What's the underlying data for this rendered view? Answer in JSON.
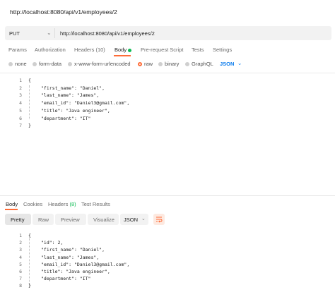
{
  "title": "http://localhost:8080/api/v1/employees/2",
  "request": {
    "method": "PUT",
    "url": "http://localhost:8080/api/v1/employees/2"
  },
  "tabs": {
    "params": "Params",
    "authorization": "Authorization",
    "headers": "Headers",
    "headers_count": "(10)",
    "body": "Body",
    "prerequest": "Pre-request Script",
    "tests": "Tests",
    "settings": "Settings"
  },
  "body_options": {
    "none": "none",
    "form_data": "form-data",
    "urlencoded": "x-www-form-urlencoded",
    "raw": "raw",
    "binary": "binary",
    "graphql": "GraphQL",
    "format": "JSON",
    "selected": "raw"
  },
  "request_body": {
    "lines": [
      {
        "num": "1",
        "text": "{"
      },
      {
        "num": "2",
        "text": "\"first_name\": \"Daniel\","
      },
      {
        "num": "3",
        "text": "\"last_name\": \"James\","
      },
      {
        "num": "4",
        "text": "\"email_id\": \"Daniel3@gmail.com\","
      },
      {
        "num": "5",
        "text": "\"title\": \"Java engineer\","
      },
      {
        "num": "6",
        "text": "\"department\": \"IT\""
      },
      {
        "num": "7",
        "text": "}"
      }
    ]
  },
  "response_tabs": {
    "body": "Body",
    "cookies": "Cookies",
    "headers": "Headers",
    "headers_count": "(8)",
    "test_results": "Test Results"
  },
  "response_view": {
    "pretty": "Pretty",
    "raw": "Raw",
    "preview": "Preview",
    "visualize": "Visualize",
    "format": "JSON"
  },
  "response_body": {
    "lines": [
      {
        "num": "1",
        "text": "{"
      },
      {
        "num": "2",
        "text": "\"id\": 2,"
      },
      {
        "num": "3",
        "text": "\"first_name\": \"Daniel\","
      },
      {
        "num": "4",
        "text": "\"last_name\": \"James\","
      },
      {
        "num": "5",
        "text": "\"email_id\": \"Daniel3@gmail.com\","
      },
      {
        "num": "6",
        "text": "\"title\": \"Java engineer\","
      },
      {
        "num": "7",
        "text": "\"department\": \"IT\""
      },
      {
        "num": "8",
        "text": "}"
      }
    ]
  },
  "colors": {
    "accent": "#ff6c37",
    "active_dot": "#0cbb52",
    "link_blue": "#097bed",
    "string": "#0451a5"
  }
}
